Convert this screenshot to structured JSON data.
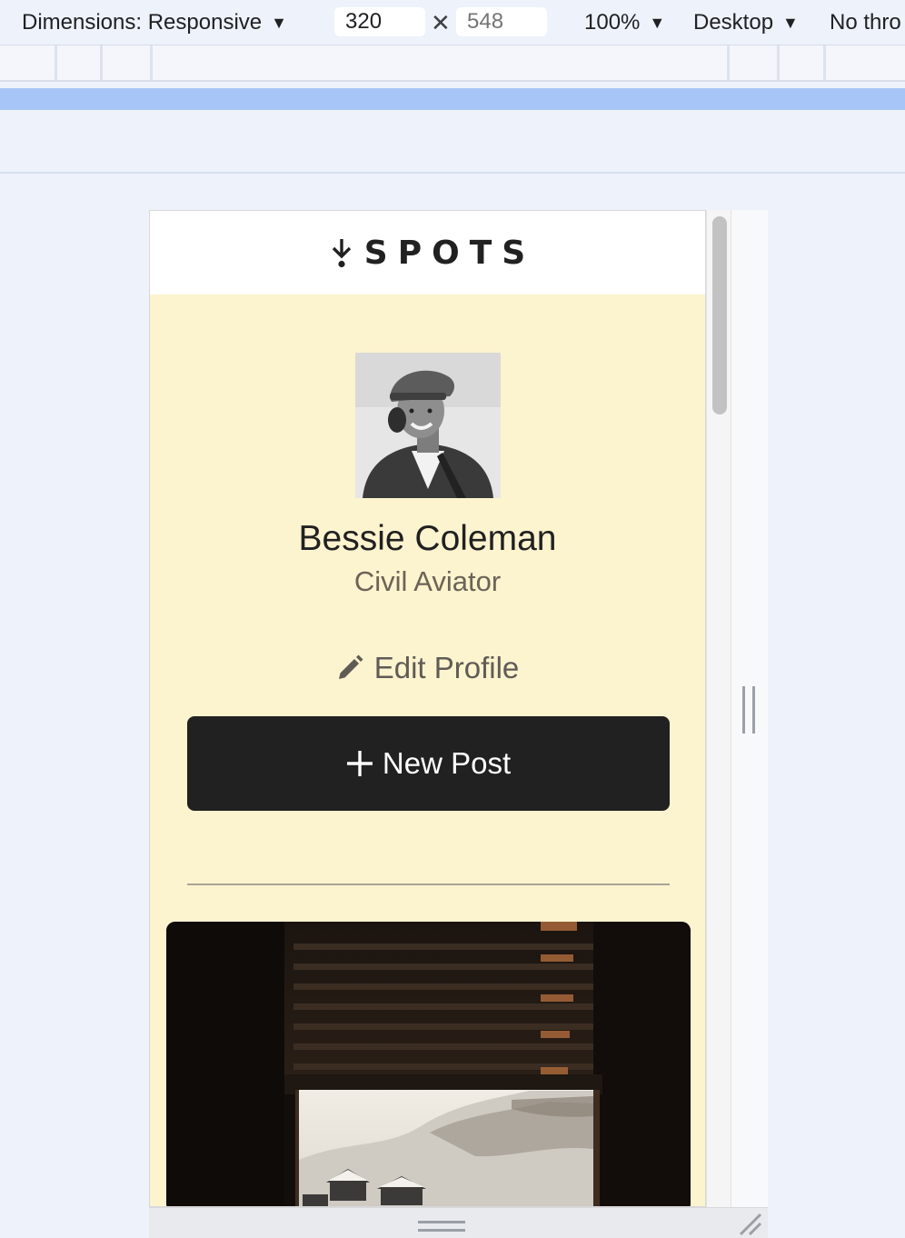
{
  "devtools": {
    "dimensions_label": "Dimensions: Responsive",
    "width_value": "320",
    "height_placeholder": "548",
    "zoom": "100%",
    "device_type": "Desktop",
    "throttle": "No thro"
  },
  "site": {
    "logo_text": "SPOTS",
    "profile": {
      "name": "Bessie Coleman",
      "role": "Civil Aviator",
      "edit_label": "Edit Profile",
      "new_post_label": "New Post"
    }
  },
  "colors": {
    "page_background": "#fcf3cf",
    "button_dark": "#212121",
    "scroll_thumb": "#c2c2c2"
  }
}
